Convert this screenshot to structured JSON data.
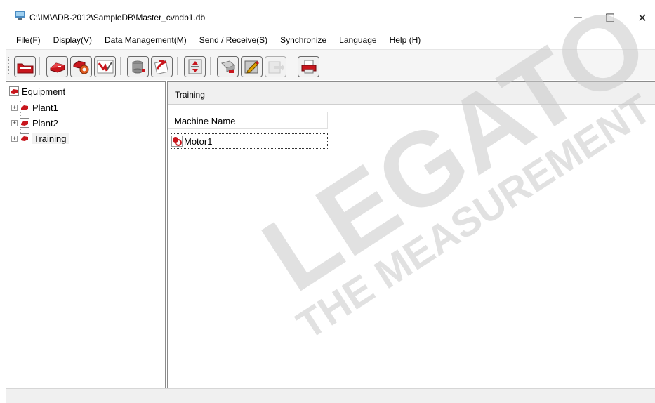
{
  "window": {
    "title": "C:\\IMV\\DB-2012\\SampleDB\\Master_cvndb1.db",
    "minimize_glyph": "─",
    "maximize_glyph": "☐",
    "close_glyph": "✕"
  },
  "menu": {
    "items": [
      {
        "label": "File(F)"
      },
      {
        "label": "Display(V)"
      },
      {
        "label": "Data Management(M)"
      },
      {
        "label": "Send / Receive(S)"
      },
      {
        "label": "Synchronize"
      },
      {
        "label": "Language"
      },
      {
        "label": "Help (H)"
      }
    ]
  },
  "toolbar": {
    "buttons": [
      {
        "icon": "open-database-icon",
        "enabled": true
      },
      {
        "icon": "equipment-icon",
        "enabled": true
      },
      {
        "icon": "equipment-settings-icon",
        "enabled": true
      },
      {
        "icon": "measurement-icon",
        "enabled": true
      },
      {
        "icon": "sensor-icon",
        "enabled": true
      },
      {
        "icon": "report-icon",
        "enabled": true
      },
      {
        "icon": "data-transfer-icon",
        "enabled": true
      },
      {
        "icon": "collector-icon",
        "enabled": true
      },
      {
        "icon": "edit-icon",
        "enabled": true
      },
      {
        "icon": "export-icon",
        "enabled": false
      },
      {
        "icon": "print-icon",
        "enabled": true
      }
    ]
  },
  "tree": {
    "root": {
      "label": "Equipment",
      "icon": "equipment-icon"
    },
    "children": [
      {
        "label": "Plant1",
        "icon": "equipment-icon",
        "expander": "+"
      },
      {
        "label": "Plant2",
        "icon": "equipment-icon",
        "expander": "+"
      },
      {
        "label": "Training",
        "icon": "equipment-icon",
        "expander": "+",
        "selected": true
      }
    ]
  },
  "content": {
    "header": "Training",
    "column": "Machine Name",
    "rows": [
      {
        "name": "Motor1",
        "icon": "motor-icon"
      }
    ]
  },
  "watermark": {
    "lines": [
      "LEGATO",
      "THE MEASUREMENT"
    ]
  },
  "colors": {
    "accent_red": "#c8161d",
    "toolbar_bg": "#f5f5f5"
  }
}
